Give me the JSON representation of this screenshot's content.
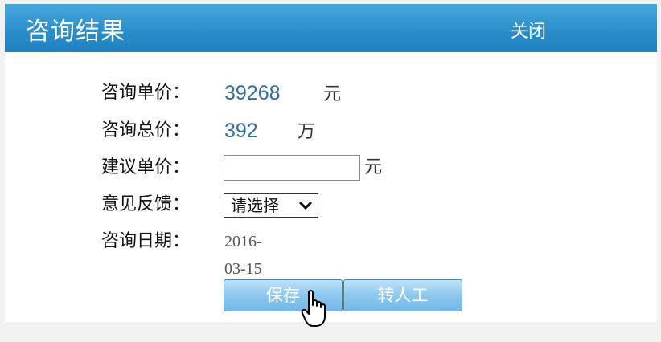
{
  "dialog": {
    "title": "咨询结果",
    "close_label": "关闭"
  },
  "form": {
    "unit_price": {
      "label": "咨询单价：",
      "value": "39268",
      "unit": "元"
    },
    "total_price": {
      "label": "咨询总价：",
      "value": "392",
      "unit": "万"
    },
    "suggested_price": {
      "label": "建议单价：",
      "value": "",
      "placeholder": "",
      "unit": "元"
    },
    "feedback": {
      "label": "意见反馈：",
      "selected": "请选择"
    },
    "date": {
      "label": "咨询日期：",
      "value": "2016-03-15"
    }
  },
  "buttons": {
    "save_label": "保存",
    "manual_label": "转人工"
  },
  "colors": {
    "header_blue": "#2b8fcb",
    "value_blue": "#2f6fa8",
    "button_blue": "#8ec8ee"
  },
  "icons": {
    "dropdown": "chevron-down-icon",
    "cursor": "hand-pointer-icon"
  }
}
